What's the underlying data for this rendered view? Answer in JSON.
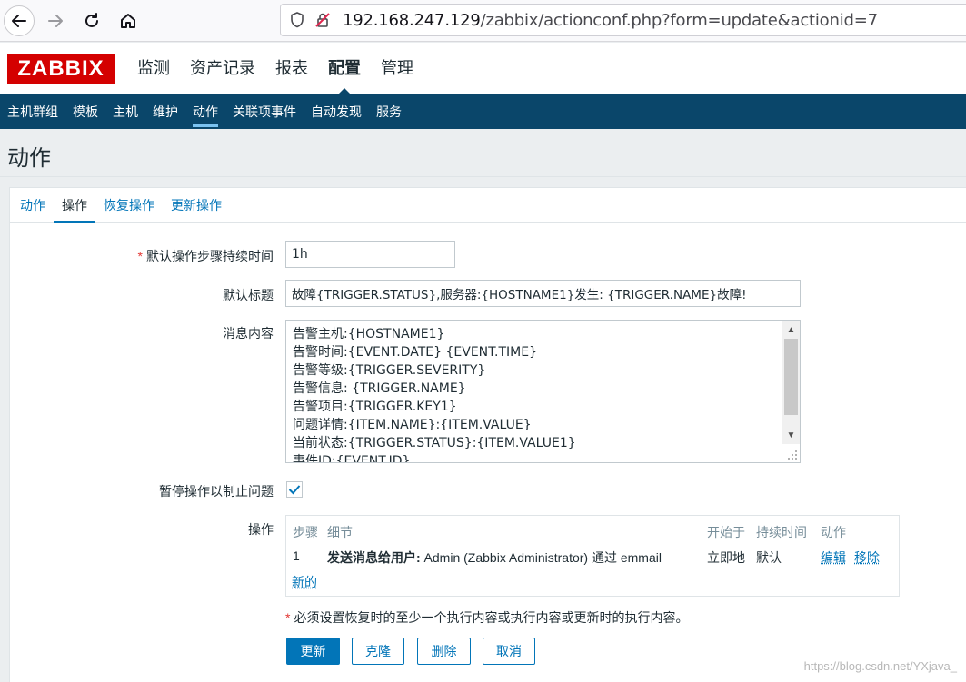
{
  "browser": {
    "url_host": "192.168.247.129",
    "url_path": "/zabbix/actionconf.php?form=update&actionid=7"
  },
  "header": {
    "logo": "ZABBIX",
    "menu": [
      "监测",
      "资产记录",
      "报表",
      "配置",
      "管理"
    ],
    "active_menu": "配置"
  },
  "subnav": {
    "items": [
      "主机群组",
      "模板",
      "主机",
      "维护",
      "动作",
      "关联项事件",
      "自动发现",
      "服务"
    ],
    "active": "动作"
  },
  "page": {
    "title": "动作"
  },
  "tabs": [
    "动作",
    "操作",
    "恢复操作",
    "更新操作"
  ],
  "form": {
    "step_duration_label": "默认操作步骤持续时间",
    "step_duration_value": "1h",
    "subject_label": "默认标题",
    "subject_value": "故障{TRIGGER.STATUS},服务器:{HOSTNAME1}发生: {TRIGGER.NAME}故障!",
    "message_label": "消息内容",
    "message_lines": [
      "告警主机:{HOSTNAME1}",
      "告警时间:{EVENT.DATE} {EVENT.TIME}",
      "告警等级:{TRIGGER.SEVERITY}",
      "告警信息: {TRIGGER.NAME}",
      "告警项目:{TRIGGER.KEY1}",
      "问题详情:{ITEM.NAME}:{ITEM.VALUE}",
      "当前状态:{TRIGGER.STATUS}:{ITEM.VALUE1}",
      "事件ID:{EVENT.ID}"
    ],
    "pause_label": "暂停操作以制止问题",
    "pause_checked": true,
    "operations_label": "操作",
    "operations_table": {
      "headers": [
        "步骤",
        "细节",
        "开始于",
        "持续时间",
        "动作"
      ],
      "rows": [
        {
          "step": "1",
          "detail_bold": "发送消息给用户:",
          "detail_rest": " Admin (Zabbix Administrator) 通过 emmail",
          "start": "立即地",
          "duration": "默认",
          "edit": "编辑",
          "remove": "移除"
        }
      ],
      "new_link": "新的"
    },
    "note": "必须设置恢复时的至少一个执行内容或执行内容或更新时的执行内容。"
  },
  "buttons": {
    "update": "更新",
    "clone": "克隆",
    "delete": "删除",
    "cancel": "取消"
  },
  "watermark": "https://blog.csdn.net/YXjava_"
}
